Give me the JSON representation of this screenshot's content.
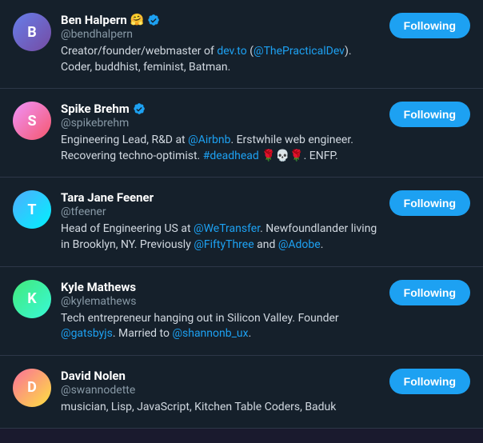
{
  "users": [
    {
      "id": "ben-halpern",
      "display_name": "Ben Halpern",
      "emoji": "🤗",
      "verified": true,
      "username": "@bendhalpern",
      "bio": "Creator/founder/webmaster of dev.to (@ThePracticalDev). Coder, buddhist, feminist, Batman.",
      "bio_parts": [
        {
          "text": "Creator/founder/webmaster of ",
          "type": "text"
        },
        {
          "text": "dev.to",
          "type": "mention"
        },
        {
          "text": " (",
          "type": "text"
        },
        {
          "text": "@ThePracticalDev",
          "type": "mention"
        },
        {
          "text": "). Coder, buddhist, feminist, Batman.",
          "type": "text"
        }
      ],
      "follow_label": "Following",
      "avatar_initial": "B",
      "avatar_class": "avatar-1"
    },
    {
      "id": "spike-brehm",
      "display_name": "Spike Brehm",
      "emoji": "",
      "verified": true,
      "username": "@spikebrehm",
      "bio": "Engineering Lead, R&D at @Airbnb. Erstwhile web engineer. Recovering techno-optimist. #deadhead 🌹💀🌹. ENFP.",
      "bio_parts": [
        {
          "text": "Engineering Lead, R&D at ",
          "type": "text"
        },
        {
          "text": "@Airbnb",
          "type": "mention"
        },
        {
          "text": ". Erstwhile web engineer. Recovering techno-optimist. ",
          "type": "text"
        },
        {
          "text": "#deadhead",
          "type": "mention"
        },
        {
          "text": " 🌹💀🌹. ENFP.",
          "type": "text"
        }
      ],
      "follow_label": "Following",
      "avatar_initial": "S",
      "avatar_class": "avatar-2"
    },
    {
      "id": "tara-jane-feener",
      "display_name": "Tara Jane Feener",
      "emoji": "",
      "verified": false,
      "username": "@tfeener",
      "bio": "Head of Engineering US at @WeTransfer. Newfoundlander living in Brooklyn, NY. Previously @FiftyThree and @Adobe.",
      "bio_parts": [
        {
          "text": "Head of Engineering US at ",
          "type": "text"
        },
        {
          "text": "@WeTransfer",
          "type": "mention"
        },
        {
          "text": ". Newfoundlander living in Brooklyn, NY. Previously ",
          "type": "text"
        },
        {
          "text": "@FiftyThree",
          "type": "mention"
        },
        {
          "text": " and ",
          "type": "text"
        },
        {
          "text": "@Adobe",
          "type": "mention"
        },
        {
          "text": ".",
          "type": "text"
        }
      ],
      "follow_label": "Following",
      "avatar_initial": "T",
      "avatar_class": "avatar-3"
    },
    {
      "id": "kyle-mathews",
      "display_name": "Kyle Mathews",
      "emoji": "",
      "verified": false,
      "username": "@kylemathews",
      "bio": "Tech entrepreneur hanging out in Silicon Valley. Founder @gatsbyjs. Married to @shannonb_ux.",
      "bio_parts": [
        {
          "text": "Tech entrepreneur hanging out in Silicon Valley. Founder ",
          "type": "text"
        },
        {
          "text": "@gatsbyjs",
          "type": "mention"
        },
        {
          "text": ". Married to ",
          "type": "text"
        },
        {
          "text": "@shannonb_ux",
          "type": "mention"
        },
        {
          "text": ".",
          "type": "text"
        }
      ],
      "follow_label": "Following",
      "avatar_initial": "K",
      "avatar_class": "avatar-4"
    },
    {
      "id": "david-nolen",
      "display_name": "David Nolen",
      "emoji": "",
      "verified": false,
      "username": "@swannodette",
      "bio": "musician, Lisp, JavaScript, Kitchen Table Coders, Baduk",
      "bio_parts": [
        {
          "text": "musician, Lisp, JavaScript, Kitchen Table Coders, Baduk",
          "type": "text"
        }
      ],
      "follow_label": "Following",
      "avatar_initial": "D",
      "avatar_class": "avatar-5"
    }
  ],
  "verified_badge_color": "#1da1f2",
  "follow_button_color": "#1da1f2"
}
